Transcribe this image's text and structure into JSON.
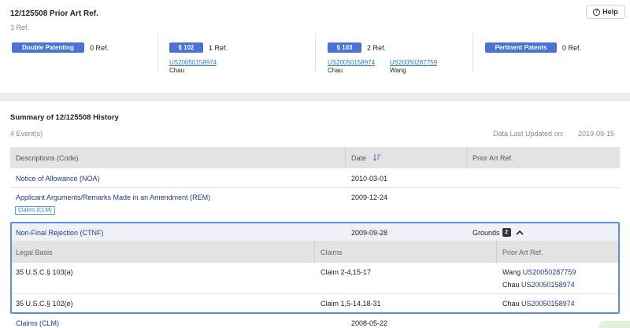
{
  "header": {
    "title": "12/125508 Prior Art Ref.",
    "ref_count": "3 Ref.",
    "help_label": "Help"
  },
  "ref_groups": [
    {
      "badge": "Double Patenting",
      "count": "0 Ref.",
      "refs": []
    },
    {
      "badge": "§ 102",
      "count": "1 Ref.",
      "refs": [
        {
          "number": "US20050158974",
          "inventor": "Chau"
        }
      ]
    },
    {
      "badge": "§ 103",
      "count": "2 Ref.",
      "refs": [
        {
          "number": "US20050158974",
          "inventor": "Chau"
        },
        {
          "number": "US20050287759",
          "inventor": "Wang"
        }
      ]
    },
    {
      "badge": "Pertinent Patents",
      "count": "0 Ref.",
      "refs": []
    }
  ],
  "history": {
    "title": "Summary of 12/125508 History",
    "event_count": "4 Event(s)",
    "last_updated_label": "Data Last Updated on:",
    "last_updated_value": "2019-09-15",
    "columns": [
      "Descriptions (Code)",
      "Date",
      "Prior Art Ref."
    ],
    "rows": [
      {
        "description": "Notice of Allowance (NOA)",
        "date": "2010-03-01"
      },
      {
        "description": "Applicant Arguments/Remarks Made in an Amendment (REM)",
        "date": "2009-12-24",
        "tag": "Claims (CLM)"
      },
      {
        "description": "Non-Final Rejection (CTNF)",
        "date": "2009-09-28",
        "grounds_label": "Grounds",
        "grounds_count": "2"
      },
      {
        "description": "Claims (CLM)",
        "date": "2008-05-22"
      }
    ],
    "grounds": {
      "columns": [
        "Legal Basis",
        "Claims",
        "Prior Art Ref."
      ],
      "rows": [
        {
          "basis": "35 U.S.C.§ 103(a)",
          "claims": "Claim 2-4,15-17",
          "refs": [
            {
              "inventor": "Wang",
              "number": "US20050287759"
            },
            {
              "inventor": "Chau",
              "number": "US20050158974"
            }
          ]
        },
        {
          "basis": "35 U.S.C.§ 102(e)",
          "claims": "Claim 1,5-14,18-31",
          "refs": [
            {
              "inventor": "Chau",
              "number": "US20050158974"
            }
          ]
        }
      ]
    }
  },
  "colors": {
    "badge": "#4a72d6",
    "link": "#2a7fb8",
    "highlight_border": "#5b8fe6"
  }
}
